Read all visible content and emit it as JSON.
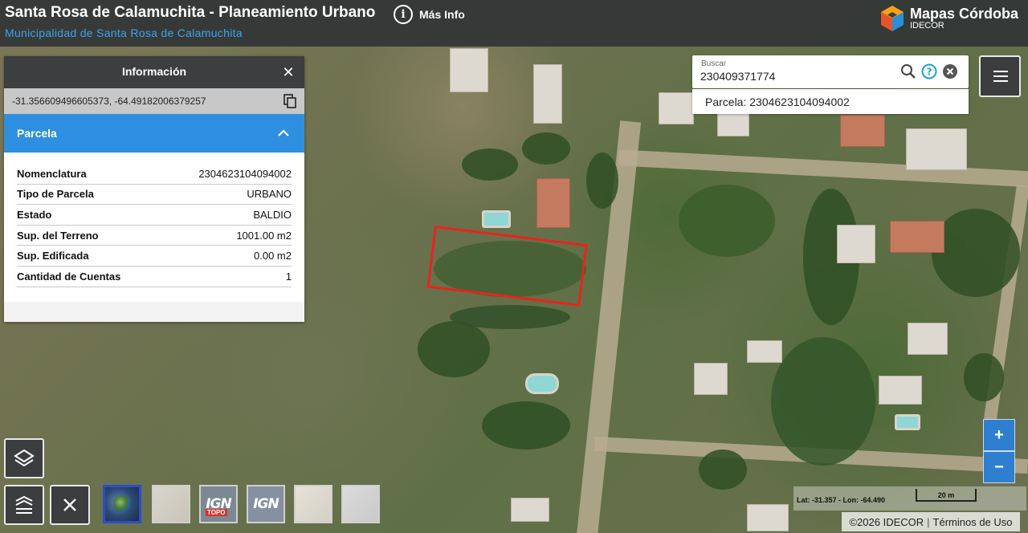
{
  "header": {
    "title": "Santa Rosa de Calamuchita - Planeamiento Urbano",
    "subtitle": "Municipalidad de Santa Rosa de Calamuchita",
    "info_label": "Más Info",
    "info_icon": "info-icon",
    "brand_name": "Mapas Córdoba",
    "brand_sub": "IDECOR"
  },
  "info_panel": {
    "title": "Información",
    "coordinates": "-31.356609496605373, -64.49182006379257",
    "section_title": "Parcela",
    "attributes": [
      {
        "label": "Nomenclatura",
        "value": "2304623104094002"
      },
      {
        "label": "Tipo de Parcela",
        "value": "URBANO"
      },
      {
        "label": "Estado",
        "value": "BALDIO"
      },
      {
        "label": "Sup. del Terreno",
        "value": "1001.00 m2"
      },
      {
        "label": "Sup. Edificada",
        "value": "0.00 m2"
      },
      {
        "label": "Cantidad de Cuentas",
        "value": "1"
      }
    ]
  },
  "search": {
    "label": "Buscar",
    "value": "230409371774",
    "result": "Parcela: 2304623104094002"
  },
  "basemaps": [
    {
      "name": "basemap-satellite",
      "label": ""
    },
    {
      "name": "basemap-light",
      "label": ""
    },
    {
      "name": "basemap-ign-topo",
      "label": "IGN",
      "sub": "TOPO"
    },
    {
      "name": "basemap-ign",
      "label": "IGN"
    },
    {
      "name": "basemap-cadastral",
      "label": ""
    },
    {
      "name": "basemap-gray",
      "label": ""
    }
  ],
  "zoom": {
    "in": "+",
    "out": "−"
  },
  "status": {
    "latlon": "Lat: -31.357 - Lon: -64.490",
    "scale": "20 m"
  },
  "footer": {
    "copyright": "©2026 IDECOR",
    "separator": "|",
    "terms": "Términos de Uso"
  },
  "colors": {
    "header_bg": "#323436",
    "accent_blue": "#2e8fe0",
    "subtitle_blue": "#3aa6e8",
    "parcel_outline": "#e8241c"
  }
}
